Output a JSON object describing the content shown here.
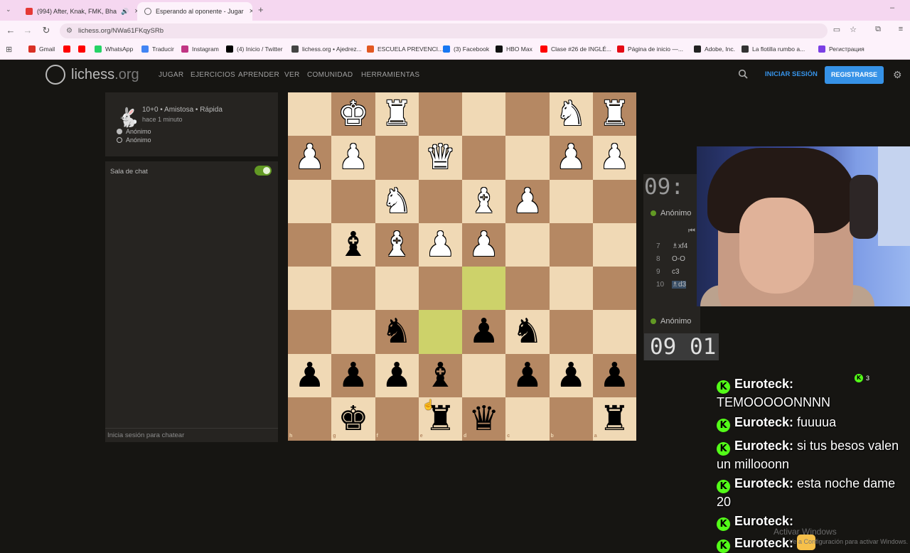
{
  "browser": {
    "tabs": [
      {
        "label": "(994) After, Knak, FMK, Bha",
        "fav_color": "#e53935"
      },
      {
        "label": "Esperando al oponente - Jugar",
        "fav_color": "#888888"
      }
    ],
    "url": "lichess.org/NWa61FKqySRb",
    "bookmarks": [
      {
        "label": "Gmail",
        "color": "#d93025"
      },
      {
        "label": "",
        "color": "#ff0000"
      },
      {
        "label": "",
        "color": "#ff0000"
      },
      {
        "label": "WhatsApp",
        "color": "#25d366"
      },
      {
        "label": "Traducir",
        "color": "#4285f4"
      },
      {
        "label": "Instagram",
        "color": "#c13584"
      },
      {
        "label": "(4) Inicio / Twitter",
        "color": "#000000"
      },
      {
        "label": "lichess.org • Ajedrez...",
        "color": "#444444"
      },
      {
        "label": "ESCUELA PREVENCI...",
        "color": "#e25822"
      },
      {
        "label": "(3) Facebook",
        "color": "#1877f2"
      },
      {
        "label": "HBO Max",
        "color": "#111111"
      },
      {
        "label": "Clase #26 de INGLÉ...",
        "color": "#ff0000"
      },
      {
        "label": "Página de inicio —...",
        "color": "#e50914"
      },
      {
        "label": "Adobe, Inc.",
        "color": "#222222"
      },
      {
        "label": "La flotilla rumbo a...",
        "color": "#333333"
      },
      {
        "label": "Регистрация",
        "color": "#7b3fe4"
      }
    ]
  },
  "site": {
    "logo": {
      "name": "lichess",
      "tld": ".org"
    },
    "nav": [
      "JUGAR",
      "EJERCICIOS",
      "APRENDER",
      "VER",
      "COMUNIDAD",
      "HERRAMIENTAS"
    ],
    "signin": "INICIAR SESIÓN",
    "register": "REGISTRARSE"
  },
  "game": {
    "title": "10+0 • Amistosa • Rápida",
    "time_ago": "hace 1 minuto",
    "players": [
      {
        "name": "Anónimo",
        "color": "white"
      },
      {
        "name": "Anónimo",
        "color": "black"
      }
    ]
  },
  "chat": {
    "label": "Sala de chat",
    "input_placeholder": "Inicia sesión para chatear"
  },
  "clocks": {
    "top": "09:",
    "bottom": "09 01"
  },
  "user_top": "Anónimo",
  "user_bottom": "Anónimo",
  "moves": [
    {
      "n": "7",
      "san": "♗xf4"
    },
    {
      "n": "8",
      "san": "O-O"
    },
    {
      "n": "9",
      "san": "c3"
    },
    {
      "n": "10",
      "san": "♗d3",
      "selected": true
    }
  ],
  "board": {
    "highlight": [
      "e6",
      "d5"
    ],
    "pieces": [
      {
        "sq": "g1",
        "p": "♚",
        "c": "w"
      },
      {
        "sq": "f1",
        "p": "♜",
        "c": "w"
      },
      {
        "sq": "b1",
        "p": "♞",
        "c": "w"
      },
      {
        "sq": "a1",
        "p": "♜",
        "c": "w"
      },
      {
        "sq": "h2",
        "p": "♟",
        "c": "w"
      },
      {
        "sq": "g2",
        "p": "♟",
        "c": "w"
      },
      {
        "sq": "e2",
        "p": "♛",
        "c": "w"
      },
      {
        "sq": "b2",
        "p": "♟",
        "c": "w"
      },
      {
        "sq": "a2",
        "p": "♟",
        "c": "w"
      },
      {
        "sq": "f3",
        "p": "♞",
        "c": "w"
      },
      {
        "sq": "d3",
        "p": "♝",
        "c": "w"
      },
      {
        "sq": "c3",
        "p": "♟",
        "c": "w"
      },
      {
        "sq": "g4",
        "p": "♝",
        "c": "b"
      },
      {
        "sq": "f4",
        "p": "♝",
        "c": "w"
      },
      {
        "sq": "e4",
        "p": "♟",
        "c": "w"
      },
      {
        "sq": "d4",
        "p": "♟",
        "c": "w"
      },
      {
        "sq": "f6",
        "p": "♞",
        "c": "b"
      },
      {
        "sq": "d6",
        "p": "♟",
        "c": "b"
      },
      {
        "sq": "c6",
        "p": "♞",
        "c": "b"
      },
      {
        "sq": "h7",
        "p": "♟",
        "c": "b"
      },
      {
        "sq": "g7",
        "p": "♟",
        "c": "b"
      },
      {
        "sq": "f7",
        "p": "♟",
        "c": "b"
      },
      {
        "sq": "e7",
        "p": "♝",
        "c": "b"
      },
      {
        "sq": "c7",
        "p": "♟",
        "c": "b"
      },
      {
        "sq": "b7",
        "p": "♟",
        "c": "b"
      },
      {
        "sq": "a7",
        "p": "♟",
        "c": "b"
      },
      {
        "sq": "g8",
        "p": "♚",
        "c": "b"
      },
      {
        "sq": "e8",
        "p": "♜",
        "c": "b"
      },
      {
        "sq": "d8",
        "p": "♛",
        "c": "b"
      },
      {
        "sq": "a8",
        "p": "♜",
        "c": "b"
      }
    ]
  },
  "stream_chat": {
    "viewers": "3",
    "lines": [
      {
        "user": "Euroteck:",
        "msg": "TEMOOOOONNNN"
      },
      {
        "user": "Euroteck:",
        "msg": "fuuuua"
      },
      {
        "user": "Euroteck:",
        "msg": "si tus besos valen un millooonn"
      },
      {
        "user": "Euroteck:",
        "msg": "esta noche dame 20"
      },
      {
        "user": "Euroteck:",
        "msg": ""
      },
      {
        "user": "Euroteck:",
        "msg": "",
        "emote": true
      }
    ]
  },
  "windows": {
    "activate": "Activar Windows",
    "activate_sub": "Ve a Configuración para activar Windows."
  }
}
